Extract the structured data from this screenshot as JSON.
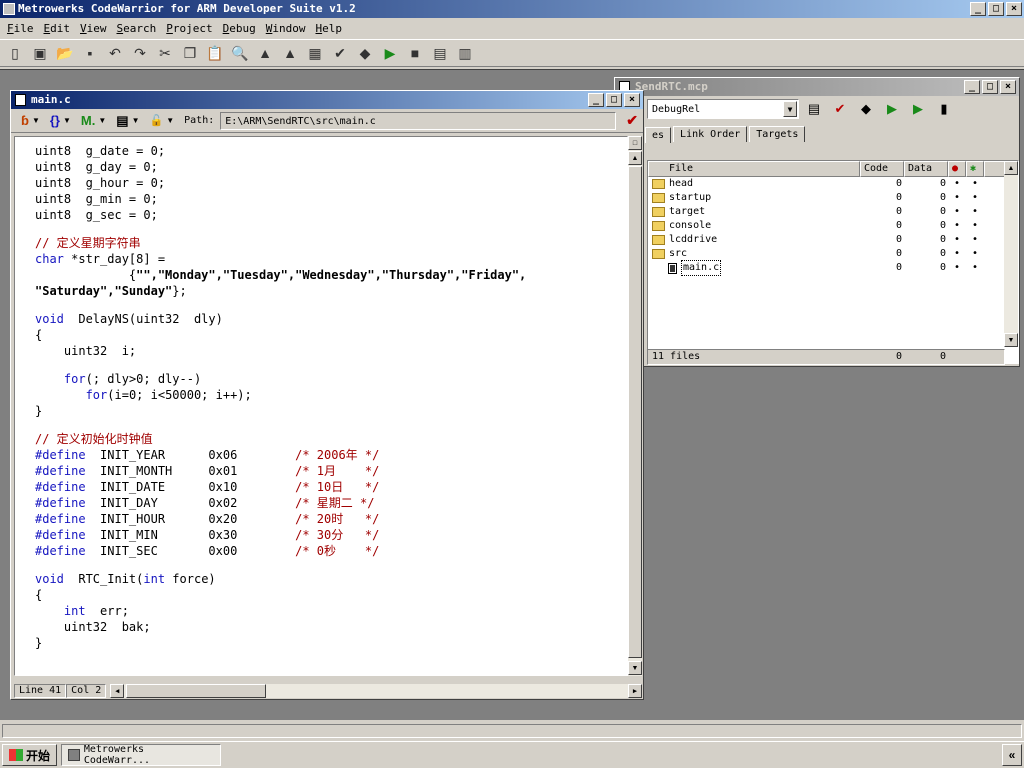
{
  "app": {
    "title": "Metrowerks CodeWarrior for ARM Developer Suite v1.2",
    "min": "_",
    "max": "□",
    "close": "×"
  },
  "menu": [
    "File",
    "Edit",
    "View",
    "Search",
    "Project",
    "Debug",
    "Window",
    "Help"
  ],
  "editor": {
    "title": "main.c",
    "path_label": "Path:",
    "path": "E:\\ARM\\SendRTC\\src\\main.c",
    "toolbar": {
      "func": "ɓ",
      "braces": "{}",
      "marks": "M.",
      "doc": "▤",
      "lock": "🔓"
    },
    "status": {
      "line": "Line 41",
      "col": "Col 2"
    },
    "code": [
      [
        [
          "",
          "uint8  g_date = 0;"
        ]
      ],
      [
        [
          "",
          "uint8  g_day = 0;"
        ]
      ],
      [
        [
          "",
          "uint8  g_hour = 0;"
        ]
      ],
      [
        [
          "",
          "uint8  g_min = 0;"
        ]
      ],
      [
        [
          "",
          "uint8  g_sec = 0;"
        ]
      ],
      [],
      [
        [
          "cm",
          "// 定义星期字符串"
        ]
      ],
      [
        [
          "kw",
          "char"
        ],
        [
          "",
          " *str_day[8] ="
        ]
      ],
      [
        [
          "",
          "             {"
        ],
        [
          "str",
          "\"\",\"Monday\",\"Tuesday\",\"Wednesday\",\"Thursday\",\"Friday\","
        ]
      ],
      [
        [
          "str",
          "\"Saturday\",\"Sunday\""
        ],
        [
          "",
          "};"
        ]
      ],
      [],
      [
        [
          "kw",
          "void"
        ],
        [
          "",
          "  DelayNS(uint32  dly)"
        ]
      ],
      [
        [
          "",
          "{"
        ]
      ],
      [
        [
          "",
          "    uint32  i;"
        ]
      ],
      [],
      [
        [
          "",
          "    "
        ],
        [
          "kw",
          "for"
        ],
        [
          "",
          "(; dly>0; dly--)"
        ]
      ],
      [
        [
          "",
          "       "
        ],
        [
          "kw",
          "for"
        ],
        [
          "",
          "(i=0; i<50000; i++);"
        ]
      ],
      [
        [
          "",
          "}"
        ]
      ],
      [],
      [
        [
          "cm",
          "// 定义初始化时钟值"
        ]
      ],
      [
        [
          "kw",
          "#define"
        ],
        [
          "",
          "  INIT_YEAR      0x06        "
        ],
        [
          "cm",
          "/* 2006年 */"
        ]
      ],
      [
        [
          "kw",
          "#define"
        ],
        [
          "",
          "  INIT_MONTH     0x01        "
        ],
        [
          "cm",
          "/* 1月    */"
        ]
      ],
      [
        [
          "kw",
          "#define"
        ],
        [
          "",
          "  INIT_DATE      0x10        "
        ],
        [
          "cm",
          "/* 10日   */"
        ]
      ],
      [
        [
          "kw",
          "#define"
        ],
        [
          "",
          "  INIT_DAY       0x02        "
        ],
        [
          "cm",
          "/* 星期二 */"
        ]
      ],
      [
        [
          "kw",
          "#define"
        ],
        [
          "",
          "  INIT_HOUR      0x20        "
        ],
        [
          "cm",
          "/* 20时   */"
        ]
      ],
      [
        [
          "kw",
          "#define"
        ],
        [
          "",
          "  INIT_MIN       0x30        "
        ],
        [
          "cm",
          "/* 30分   */"
        ]
      ],
      [
        [
          "kw",
          "#define"
        ],
        [
          "",
          "  INIT_SEC       0x00        "
        ],
        [
          "cm",
          "/* 0秒    */"
        ]
      ],
      [],
      [
        [
          "kw",
          "void"
        ],
        [
          "",
          "  RTC_Init("
        ],
        [
          "kw",
          "int"
        ],
        [
          "",
          " force)"
        ]
      ],
      [
        [
          "",
          "{"
        ]
      ],
      [
        [
          "",
          "    "
        ],
        [
          "kw",
          "int"
        ],
        [
          "",
          "  err;"
        ]
      ],
      [
        [
          "",
          "    uint32  bak;"
        ]
      ],
      [
        [
          "",
          "}"
        ]
      ]
    ]
  },
  "project": {
    "title": "SendRTC.mcp",
    "target": "DebugRel",
    "tabs": [
      "es",
      "Link Order",
      "Targets"
    ],
    "columns": {
      "file": "File",
      "code": "Code",
      "data": "Data"
    },
    "rows": [
      {
        "name": "head",
        "type": "folder",
        "code": "0",
        "data": "0"
      },
      {
        "name": "startup",
        "type": "folder",
        "code": "0",
        "data": "0"
      },
      {
        "name": "target",
        "type": "folder",
        "code": "0",
        "data": "0"
      },
      {
        "name": "console",
        "type": "folder",
        "code": "0",
        "data": "0"
      },
      {
        "name": "lcddrive",
        "type": "folder",
        "code": "0",
        "data": "0"
      },
      {
        "name": "src",
        "type": "folder-open",
        "code": "0",
        "data": "0"
      },
      {
        "name": "main.c",
        "type": "file",
        "code": "0",
        "data": "0"
      }
    ],
    "footer": {
      "files": "11 files",
      "code": "0",
      "data": "0"
    }
  },
  "taskbar": {
    "start": "开始",
    "item": "Metrowerks CodeWarr...",
    "tray": "«"
  }
}
